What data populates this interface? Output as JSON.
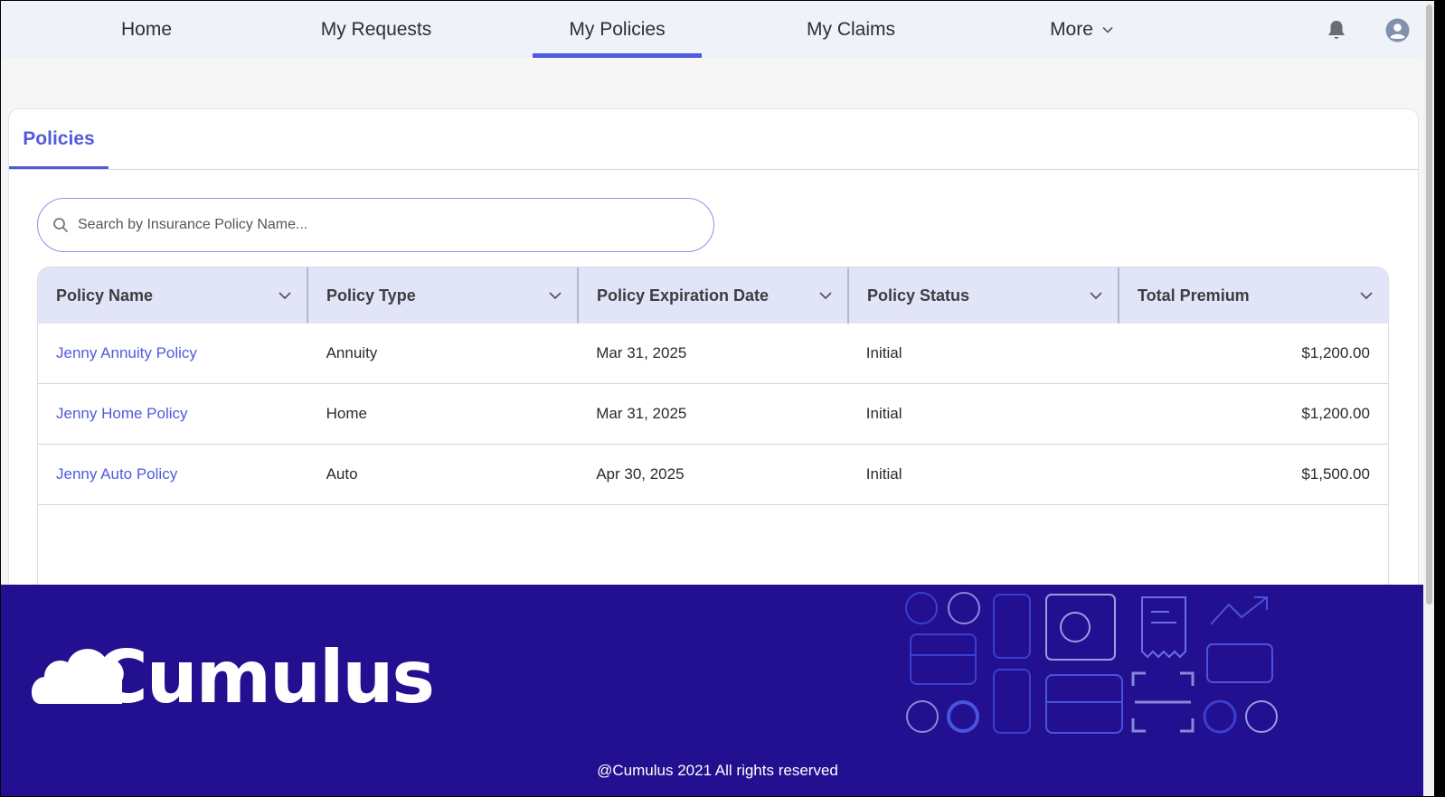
{
  "nav": {
    "items": [
      {
        "label": "Home"
      },
      {
        "label": "My Requests"
      },
      {
        "label": "My Policies"
      },
      {
        "label": "My Claims"
      },
      {
        "label": "More"
      }
    ],
    "active_index": 2
  },
  "card": {
    "tab_label": "Policies"
  },
  "search": {
    "placeholder": "Search by Insurance Policy Name...",
    "value": ""
  },
  "table": {
    "columns": [
      "Policy Name",
      "Policy Type",
      "Policy Expiration Date",
      "Policy Status",
      "Total Premium"
    ],
    "rows": [
      {
        "name": "Jenny Annuity Policy",
        "type": "Annuity",
        "expiration": "Mar 31, 2025",
        "status": "Initial",
        "premium": "$1,200.00"
      },
      {
        "name": "Jenny Home Policy",
        "type": "Home",
        "expiration": "Mar 31, 2025",
        "status": "Initial",
        "premium": "$1,200.00"
      },
      {
        "name": "Jenny Auto Policy",
        "type": "Auto",
        "expiration": "Apr 30, 2025",
        "status": "Initial",
        "premium": "$1,500.00"
      }
    ]
  },
  "footer": {
    "brand": "Cumulus",
    "copyright": "@Cumulus 2021 All rights reserved"
  },
  "colors": {
    "accent": "#4f5bdc",
    "header_bg": "#eff2f9",
    "table_header_bg": "#e1e5f7",
    "footer_bg": "#221090"
  },
  "icons": [
    "chevron-down-icon",
    "bell-icon",
    "user-avatar-icon",
    "search-icon",
    "sort-chevron-icon",
    "cloud-logo-icon"
  ]
}
